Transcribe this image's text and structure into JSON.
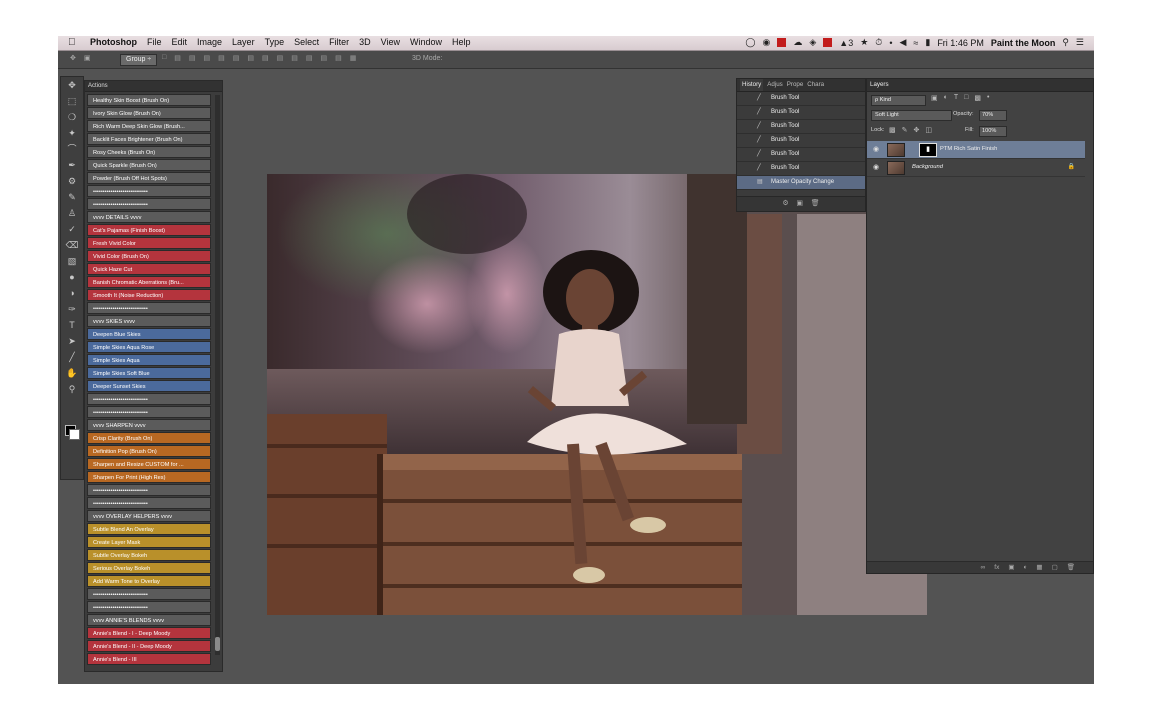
{
  "menubar": {
    "apple": "",
    "items": [
      "Photoshop",
      "File",
      "Edit",
      "Image",
      "Layer",
      "Type",
      "Select",
      "Filter",
      "3D",
      "View",
      "Window",
      "Help"
    ],
    "status_icons": [
      "lock-icon",
      "eye-icon",
      "adobe-icon",
      "cloud-icon",
      "dropbox-icon",
      "flash-icon",
      "acrobat-icon",
      "av-icon",
      "timer-icon",
      "bluetooth-icon",
      "volume-icon",
      "wifi-icon",
      "battery-icon"
    ],
    "clock": "Fri 1:46 PM",
    "user": "Paint the Moon",
    "av_count": "3"
  },
  "options_bar": {
    "group_label": "Group ÷",
    "mode_label": "3D Mode:"
  },
  "actions_panel": {
    "title": "Actions",
    "colors": {
      "gray": "#5b5b5b",
      "red": "#b4343d",
      "blue": "#4b6a9c",
      "orange": "#b86822",
      "gold": "#b9902a"
    },
    "items": [
      {
        "label": "Healthy Skin Boost (Brush On)",
        "color": "gray"
      },
      {
        "label": "Ivory Skin Glow (Brush On)",
        "color": "gray"
      },
      {
        "label": "Rich Warm Deep Skin Glow (Brush...",
        "color": "gray"
      },
      {
        "label": "Backlit Faces Brightener (Brush On)",
        "color": "gray"
      },
      {
        "label": "Rosy Cheeks (Brush On)",
        "color": "gray"
      },
      {
        "label": "Quick Sparkle (Brush On)",
        "color": "gray"
      },
      {
        "label": "Powder (Brush Off Hot Spots)",
        "color": "gray"
      },
      {
        "label": "••••••••••••••••••••••••••••",
        "color": "gray"
      },
      {
        "label": "••••••••••••••••••••••••••••",
        "color": "gray"
      },
      {
        "label": "vvvv  DETAILS vvvv",
        "color": "gray"
      },
      {
        "label": "Cat's Pajamas (Finish Boost)",
        "color": "red"
      },
      {
        "label": "Fresh Vivid Color",
        "color": "red"
      },
      {
        "label": "Vivid Color (Brush On)",
        "color": "red"
      },
      {
        "label": "Quick Haze Cut",
        "color": "red"
      },
      {
        "label": "Banish Chromatic Aberrations (Bru...",
        "color": "red"
      },
      {
        "label": "Smooth It (Noise Reduction)",
        "color": "red"
      },
      {
        "label": "••••••••••••••••••••••••••••",
        "color": "gray"
      },
      {
        "label": "vvvv  SKIES  vvvv",
        "color": "gray"
      },
      {
        "label": "Deepen Blue Skies",
        "color": "blue"
      },
      {
        "label": "Simple Skies Aqua Rose",
        "color": "blue"
      },
      {
        "label": "Simple Skies Aqua",
        "color": "blue"
      },
      {
        "label": "Simple Skies Soft Blue",
        "color": "blue"
      },
      {
        "label": "Deeper Sunset Skies",
        "color": "blue"
      },
      {
        "label": "••••••••••••••••••••••••••••",
        "color": "gray"
      },
      {
        "label": "••••••••••••••••••••••••••••",
        "color": "gray"
      },
      {
        "label": "vvvv  SHARPEN vvvv",
        "color": "gray"
      },
      {
        "label": "Crisp Clarity (Brush On)",
        "color": "orange"
      },
      {
        "label": "Definition Pop (Brush On)",
        "color": "orange"
      },
      {
        "label": "Sharpen and Resize CUSTOM for ...",
        "color": "orange"
      },
      {
        "label": "Sharpen For Print (High Res)",
        "color": "orange"
      },
      {
        "label": "••••••••••••••••••••••••••••",
        "color": "gray"
      },
      {
        "label": "••••••••••••••••••••••••••••",
        "color": "gray"
      },
      {
        "label": "vvvv  OVERLAY HELPERS vvvv",
        "color": "gray"
      },
      {
        "label": "Subtle Blend An Overlay",
        "color": "gold"
      },
      {
        "label": "Create Layer Mask",
        "color": "gold"
      },
      {
        "label": "Subtle Overlay Bokeh",
        "color": "gold"
      },
      {
        "label": "Serious Overlay Bokeh",
        "color": "gold"
      },
      {
        "label": "Add Warm Tone to Overlay",
        "color": "gold"
      },
      {
        "label": "••••••••••••••••••••••••••••",
        "color": "gray"
      },
      {
        "label": "••••••••••••••••••••••••••••",
        "color": "gray"
      },
      {
        "label": "vvvv  ANNIE'S BLENDS vvvv",
        "color": "gray"
      },
      {
        "label": "Annie's Blend - I - Deep Moody",
        "color": "red"
      },
      {
        "label": "Annie's Blend - II - Deep Moody",
        "color": "red"
      },
      {
        "label": "Annie's Blend - III",
        "color": "red"
      }
    ]
  },
  "history_panel": {
    "tabs": [
      "History",
      "Adjus",
      "Prope",
      "Chara"
    ],
    "items": [
      {
        "label": "Brush Tool",
        "selected": false
      },
      {
        "label": "Brush Tool",
        "selected": false
      },
      {
        "label": "Brush Tool",
        "selected": false
      },
      {
        "label": "Brush Tool",
        "selected": false
      },
      {
        "label": "Brush Tool",
        "selected": false
      },
      {
        "label": "Brush Tool",
        "selected": false
      },
      {
        "label": "Master Opacity Change",
        "selected": true
      }
    ]
  },
  "layers_panel": {
    "title": "Layers",
    "filter_label": "ρ Kind",
    "blend_mode": "Soft Light",
    "opacity_label": "Opacity:",
    "opacity_value": "70%",
    "lock_label": "Lock:",
    "fill_label": "Fill:",
    "fill_value": "100%",
    "layers": [
      {
        "name": "PTM Rich Satin Finish",
        "selected": true,
        "has_mask": true
      },
      {
        "name": "Background",
        "selected": false,
        "has_mask": false
      }
    ]
  }
}
